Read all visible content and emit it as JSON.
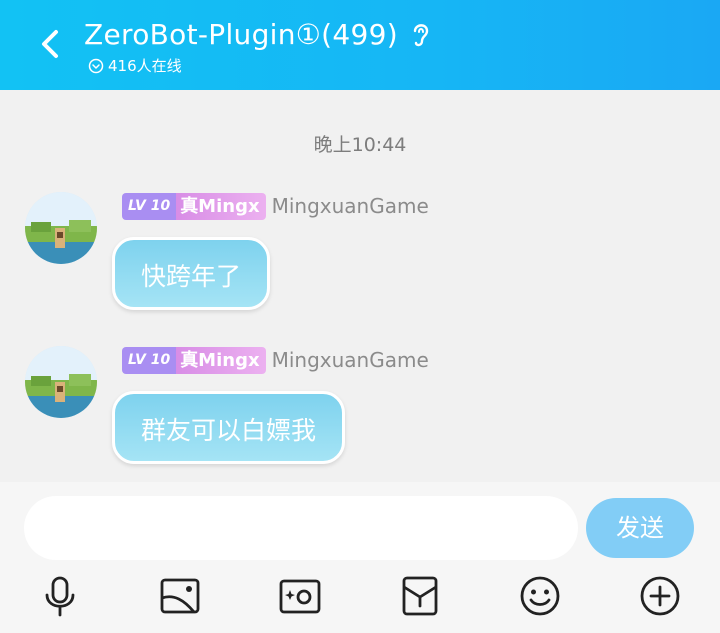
{
  "header": {
    "title": "ZeroBot-Plugin①(499)",
    "online": "416人在线"
  },
  "chat": {
    "time": "晚上10:44",
    "messages": [
      {
        "level": "LV 10",
        "tag": "真Mingx",
        "nickname": "MingxuanGame",
        "text": "快跨年了"
      },
      {
        "level": "LV 10",
        "tag": "真Mingx",
        "nickname": "MingxuanGame",
        "text": "群友可以白嫖我"
      }
    ]
  },
  "input": {
    "value": "",
    "send_label": "发送"
  },
  "toolbar": {
    "icons": [
      "microphone-icon",
      "image-icon",
      "camera-icon",
      "red-packet-icon",
      "emoji-icon",
      "plus-icon"
    ]
  },
  "colors": {
    "header": "#16b6f5",
    "bubble": "#8fdaf1",
    "level_badge": "#a98ef2",
    "send_button": "#82cdf6"
  }
}
